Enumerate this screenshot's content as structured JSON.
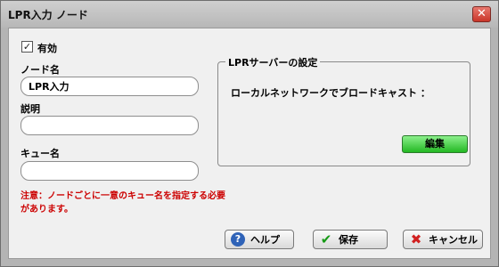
{
  "window": {
    "title": "LPR入力 ノード",
    "close_glyph": "✕"
  },
  "form": {
    "enabled_label": "有効",
    "enabled_checked": true,
    "node_name_label": "ノード名",
    "node_name_value": "LPR入力",
    "description_label": "説明",
    "description_value": "",
    "queue_name_label": "キュー名",
    "queue_name_value": "",
    "note": "注意：ノードごとに一意のキュー名を指定する必要があります。"
  },
  "lpr_server": {
    "group_title": "LPRサーバーの設定",
    "broadcast_label": "ローカルネットワークでブロードキャスト ：",
    "edit_label": "編集"
  },
  "buttons": {
    "help_label": "ヘルプ",
    "save_label": "保存",
    "cancel_label": "キャンセル"
  },
  "colors": {
    "note_text": "#cc0000",
    "edit_button": "#3cc83c",
    "close_button": "#d9473b"
  }
}
